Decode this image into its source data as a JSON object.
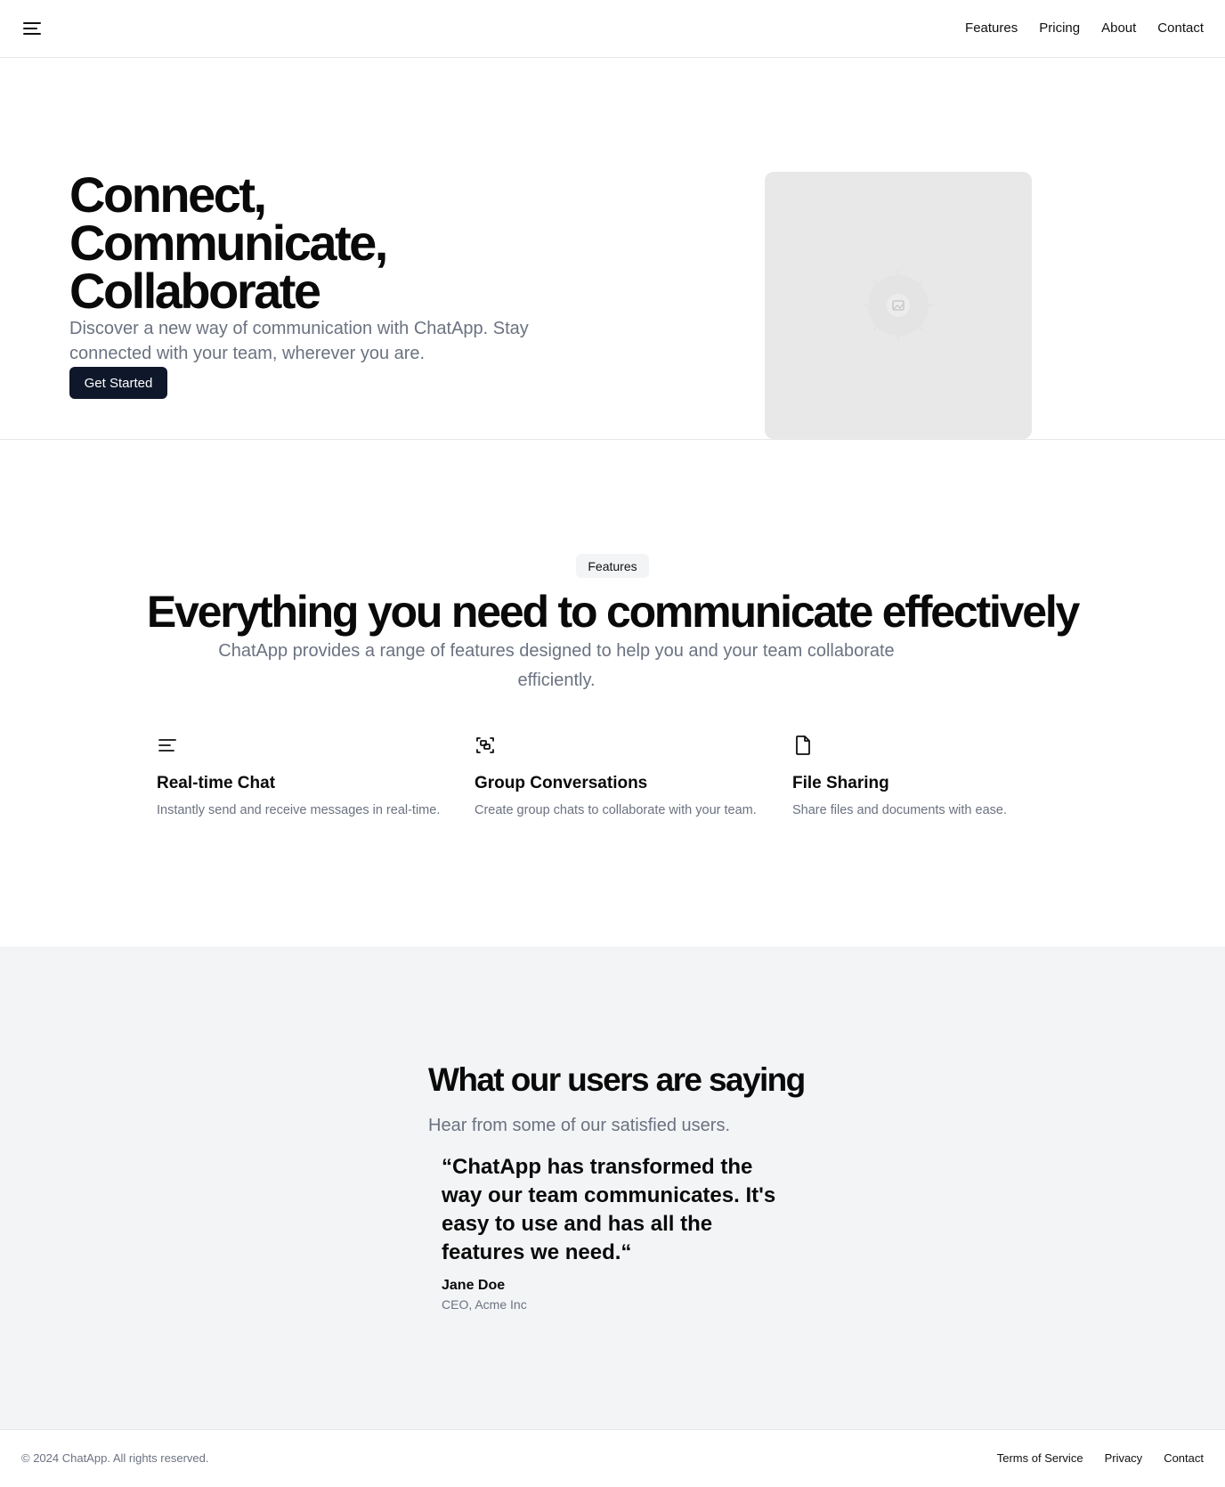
{
  "header": {
    "menu_icon": "menu-icon",
    "nav": [
      "Features",
      "Pricing",
      "About",
      "Contact"
    ]
  },
  "hero": {
    "title_lines": [
      "Connect,",
      "Communicate,",
      "Collaborate"
    ],
    "subtitle": "Discover a new way of communication with ChatApp. Stay connected with your team, wherever you are.",
    "cta": "Get Started",
    "image_icon": "image-placeholder-icon"
  },
  "features": {
    "badge": "Features",
    "title": "Everything you need to communicate effectively",
    "subtitle": "ChatApp provides a range of features designed to help you and your team collaborate efficiently.",
    "items": [
      {
        "icon": "text-lines-icon",
        "title": "Real-time Chat",
        "description": "Instantly send and receive messages in real-time."
      },
      {
        "icon": "group-icon",
        "title": "Group Conversations",
        "description": "Create group chats to collaborate with your team."
      },
      {
        "icon": "file-icon",
        "title": "File Sharing",
        "description": "Share files and documents with ease."
      }
    ]
  },
  "testimonials": {
    "title": "What our users are saying",
    "subtitle": "Hear from some of our satisfied users.",
    "quote": "“ChatApp has transformed the way our team communicates. It's easy to use and has all the features we need.“",
    "author": "Jane Doe",
    "role": "CEO, Acme Inc"
  },
  "footer": {
    "copyright": "© 2024 ChatApp. All rights reserved.",
    "links": [
      "Terms of Service",
      "Privacy",
      "Contact"
    ]
  },
  "colors": {
    "primary_button": "#0f172a",
    "muted_text": "#6b7280",
    "section_bg": "#f3f4f6",
    "border": "#e5e7eb"
  }
}
